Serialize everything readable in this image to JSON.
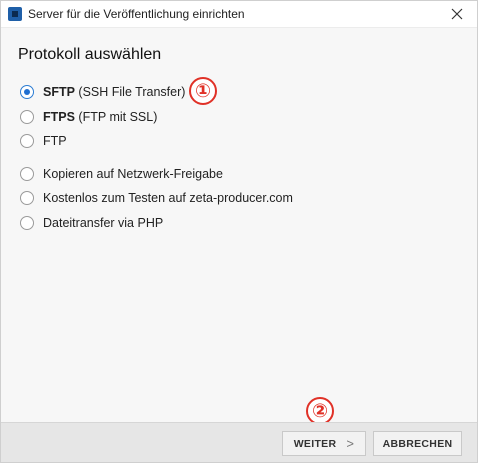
{
  "window": {
    "title": "Server für die Veröffentlichung einrichten"
  },
  "heading": "Protokoll auswählen",
  "options": [
    {
      "strong": "SFTP",
      "rest": " (SSH File Transfer)",
      "selected": true
    },
    {
      "strong": "FTPS",
      "rest": " (FTP mit SSL)",
      "selected": false
    },
    {
      "strong": "",
      "rest": "FTP",
      "selected": false
    },
    {
      "strong": "",
      "rest": "Kopieren auf Netzwerk-Freigabe",
      "selected": false
    },
    {
      "strong": "",
      "rest": "Kostenlos zum Testen auf zeta-producer.com",
      "selected": false
    },
    {
      "strong": "",
      "rest": "Dateitransfer via PHP",
      "selected": false
    }
  ],
  "markers": {
    "one": "①",
    "two": "②"
  },
  "buttons": {
    "next": "WEITER",
    "cancel": "ABBRECHEN"
  },
  "colors": {
    "accent": "#1f6fd1",
    "marker": "#e03127"
  },
  "icons": {
    "close": "close-icon",
    "next": "chevron-right-icon",
    "app": "app-icon"
  }
}
